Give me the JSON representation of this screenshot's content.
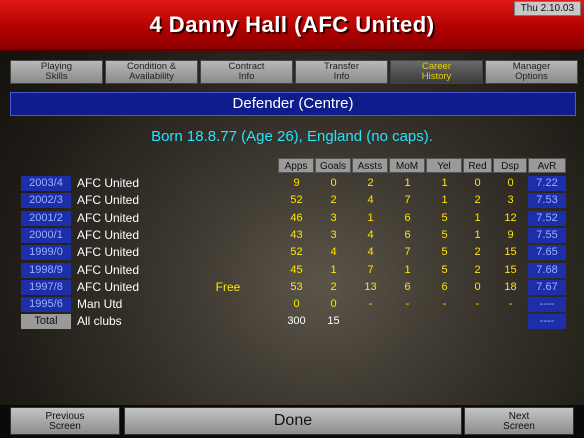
{
  "header": {
    "title": "4 Danny Hall (AFC United)",
    "date": "Thu 2.10.03",
    "brand_color": "#c80000"
  },
  "tabs": [
    {
      "label": "Playing\nSkills",
      "active": false
    },
    {
      "label": "Condition &\nAvailability",
      "active": false
    },
    {
      "label": "Contract\nInfo",
      "active": false
    },
    {
      "label": "Transfer\nInfo",
      "active": false
    },
    {
      "label": "Career\nHistory",
      "active": true
    },
    {
      "label": "Manager\nOptions",
      "active": false
    }
  ],
  "position": "Defender (Centre)",
  "born": "Born 18.8.77 (Age 26), England (no caps).",
  "columns": [
    "Apps",
    "Goals",
    "Assts",
    "MoM",
    "Yel",
    "Red",
    "Dsp",
    "AvR"
  ],
  "rows": [
    {
      "season": "2003/4",
      "club": "AFC United",
      "fee": "",
      "apps": "9",
      "goals": "0",
      "assts": "2",
      "mom": "1",
      "yel": "1",
      "red": "0",
      "dsp": "0",
      "avr": "7.22"
    },
    {
      "season": "2002/3",
      "club": "AFC United",
      "fee": "",
      "apps": "52",
      "goals": "2",
      "assts": "4",
      "mom": "7",
      "yel": "1",
      "red": "2",
      "dsp": "3",
      "avr": "7.53"
    },
    {
      "season": "2001/2",
      "club": "AFC United",
      "fee": "",
      "apps": "46",
      "goals": "3",
      "assts": "1",
      "mom": "6",
      "yel": "5",
      "red": "1",
      "dsp": "12",
      "avr": "7.52"
    },
    {
      "season": "2000/1",
      "club": "AFC United",
      "fee": "",
      "apps": "43",
      "goals": "3",
      "assts": "4",
      "mom": "6",
      "yel": "5",
      "red": "1",
      "dsp": "9",
      "avr": "7.55"
    },
    {
      "season": "1999/0",
      "club": "AFC United",
      "fee": "",
      "apps": "52",
      "goals": "4",
      "assts": "4",
      "mom": "7",
      "yel": "5",
      "red": "2",
      "dsp": "15",
      "avr": "7.65"
    },
    {
      "season": "1998/9",
      "club": "AFC United",
      "fee": "",
      "apps": "45",
      "goals": "1",
      "assts": "7",
      "mom": "1",
      "yel": "5",
      "red": "2",
      "dsp": "15",
      "avr": "7.68"
    },
    {
      "season": "1997/8",
      "club": "AFC United",
      "fee": "Free",
      "apps": "53",
      "goals": "2",
      "assts": "13",
      "mom": "6",
      "yel": "6",
      "red": "0",
      "dsp": "18",
      "avr": "7.67"
    },
    {
      "season": "1995/6",
      "club": "Man Utd",
      "fee": "",
      "apps": "0",
      "goals": "0",
      "assts": "-",
      "mom": "-",
      "yel": "-",
      "red": "-",
      "dsp": "-",
      "avr": "----"
    }
  ],
  "total": {
    "season": "Total",
    "club": "All clubs",
    "apps": "300",
    "goals": "15",
    "avr": "----"
  },
  "footer": {
    "prev": "Previous\nScreen",
    "done": "Done",
    "next": "Next\nScreen"
  }
}
